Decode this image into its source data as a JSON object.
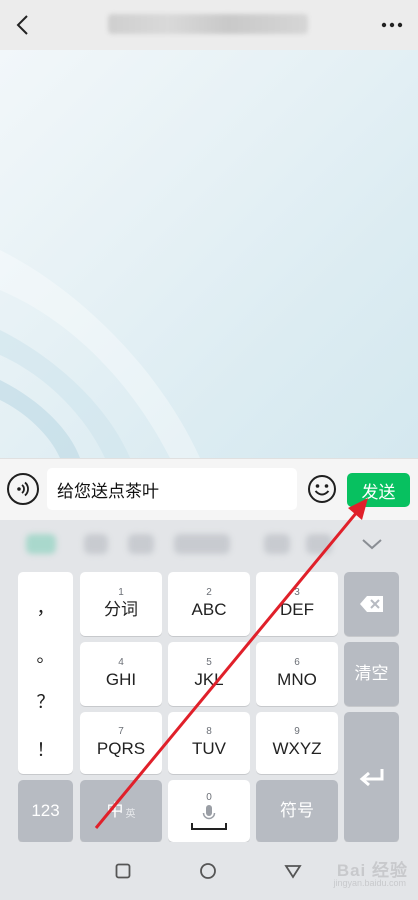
{
  "header": {
    "back_icon": "chevron-left-icon",
    "more_icon": "more-dots-icon"
  },
  "composer": {
    "message_text": "给您送点茶叶",
    "send_label": "发送",
    "send_color": "#07c160",
    "voice_icon": "voice-icon",
    "emoji_icon": "emoji-icon"
  },
  "keyboard": {
    "symbols": [
      "，",
      "。",
      "？",
      "！"
    ],
    "rows": [
      [
        {
          "num": "1",
          "label": "分词"
        },
        {
          "num": "2",
          "label": "ABC"
        },
        {
          "num": "3",
          "label": "DEF"
        }
      ],
      [
        {
          "num": "4",
          "label": "GHI"
        },
        {
          "num": "5",
          "label": "JKL"
        },
        {
          "num": "6",
          "label": "MNO"
        }
      ],
      [
        {
          "num": "7",
          "label": "PQRS"
        },
        {
          "num": "8",
          "label": "TUV"
        },
        {
          "num": "9",
          "label": "WXYZ"
        }
      ]
    ],
    "clear_label": "清空",
    "num_switch_label": "123",
    "lang_label": "中",
    "lang_sub": "英",
    "space_num": "0",
    "symbol_label": "符号"
  },
  "nav": {
    "watermark": "Bai 经验",
    "watermark_sub": "jingyan.baidu.com"
  },
  "annotation_color": "#e0202a"
}
